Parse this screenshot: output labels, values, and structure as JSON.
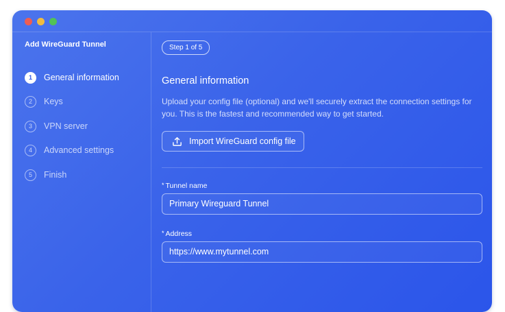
{
  "window": {
    "traffic_lights": {
      "close": "#ee5d52",
      "minimize": "#f1bc3e",
      "zoom": "#52c257"
    }
  },
  "sidebar": {
    "title": "Add WireGuard Tunnel",
    "steps": [
      {
        "number": "1",
        "label": "General information",
        "active": true
      },
      {
        "number": "2",
        "label": "Keys",
        "active": false
      },
      {
        "number": "3",
        "label": "VPN server",
        "active": false
      },
      {
        "number": "4",
        "label": "Advanced settings",
        "active": false
      },
      {
        "number": "5",
        "label": "Finish",
        "active": false
      }
    ]
  },
  "main": {
    "step_badge": "Step 1 of 5",
    "heading": "General information",
    "description": "Upload your config file (optional) and we'll securely extract the connection settings for you. This is the fastest and recommended way to get started.",
    "import_button": {
      "label": "Import WireGuard config file",
      "icon": "upload-icon"
    },
    "fields": {
      "tunnel_name": {
        "required_mark": "*",
        "label": "Tunnel name",
        "value": "Primary Wireguard Tunnel"
      },
      "address": {
        "required_mark": "*",
        "label": "Address",
        "value": "https://www.mytunnel.com"
      }
    }
  },
  "colors": {
    "background_accent": "#3a63ea",
    "active_step_text": "#2f5ae8"
  }
}
